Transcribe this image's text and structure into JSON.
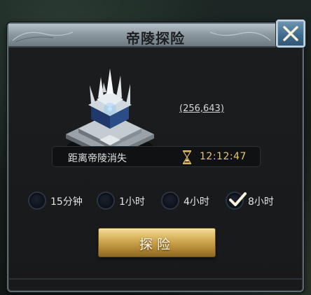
{
  "dialog": {
    "title": "帝陵探险",
    "close_icon": "close-icon"
  },
  "location": {
    "building_icon": "imperial-tomb-icon",
    "coords": "(256,643)"
  },
  "countdown": {
    "label": "距离帝陵消失",
    "icon": "hourglass-icon",
    "value": "12:12:47"
  },
  "duration_options": [
    {
      "label": "15分钟",
      "selected": false
    },
    {
      "label": "1小时",
      "selected": false
    },
    {
      "label": "4小时",
      "selected": false
    },
    {
      "label": "8小时",
      "selected": true
    }
  ],
  "explore_button": {
    "label": "探险"
  },
  "colors": {
    "accent_gold": "#e8c66a",
    "close_blue": "#3e6a8c"
  }
}
